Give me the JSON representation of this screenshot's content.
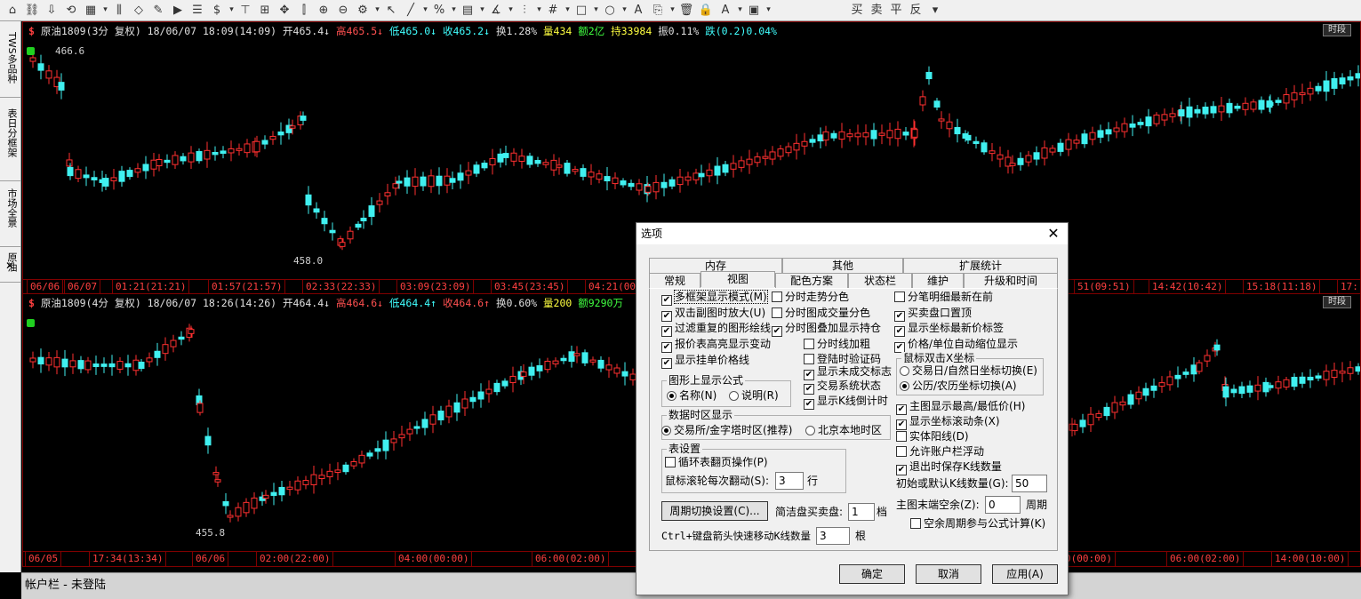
{
  "toolbar": {
    "tools": [
      "⌂",
      "⛓",
      "⇩",
      "⟲",
      "▦",
      "▾",
      "⫼",
      "◇",
      "✎",
      "▶",
      "☰",
      "$",
      "▾",
      "⊤",
      "⊞",
      "✥",
      "⫿",
      "⊕",
      "⊖",
      "⚙",
      "▾",
      "↖",
      "╱",
      "▾",
      "%",
      "▾",
      "▤",
      "▾",
      "∡",
      "▾",
      "⫶",
      "▾",
      "#",
      "▾",
      "□",
      "▾",
      "○",
      "▾",
      "A",
      "⎘",
      "▾",
      "🗑",
      "🔒",
      "A",
      "▾",
      "▣",
      "▾"
    ],
    "labels": [
      "买",
      "卖",
      "平",
      "反",
      "▾"
    ]
  },
  "sidebar": {
    "items": [
      "TWS多品种",
      "表日分框架",
      "市场全景",
      "原油"
    ],
    "close": "✕"
  },
  "chart_top": {
    "dollar": "$",
    "title": "原油1809(3分 复权) 18/06/07 18:09(14:09)",
    "open": "开465.4↓",
    "high": "高465.5↓",
    "low": "低465.0↓",
    "close": "收465.2↓",
    "turnover": "换1.28%",
    "volume": "量434",
    "amount": "额2亿",
    "position": "持33984",
    "amplitude": "振0.11%",
    "change": "跌(0.2)0.04%",
    "history": "时段",
    "high_label": "466.6",
    "low_label": "458.0",
    "times": [
      "06/06",
      "06/07",
      "01:21(21:21)",
      "01:57(21:57)",
      "02:33(22:33)",
      "03:09(23:09)",
      "03:45(23:45)",
      "04:21(00",
      "51(09:51)",
      "14:42(10:42)",
      "15:18(11:18)",
      "17:"
    ]
  },
  "chart_bottom": {
    "dollar": "$",
    "title": "原油1809(4分 复权) 18/06/07 18:26(14:26)",
    "open": "开464.4↓",
    "high": "高464.6↓",
    "low": "低464.4↑",
    "close": "收464.6↑",
    "turnover": "换0.60%",
    "volume": "量200",
    "amount": "额9290万",
    "history": "时段",
    "low_label": "455.8",
    "times": [
      "06/05",
      "17:34(13:34)",
      "06/06",
      "02:00(22:00)",
      "04:00(00:00)",
      "06:00(02:00)",
      "0(00:00)",
      "06:00(02:00)",
      "14:00(10:00)"
    ]
  },
  "status": {
    "text": "帐户栏 - 未登陆"
  },
  "dialog": {
    "title": "选项",
    "close": "✕",
    "tabs_back": [
      "内存",
      "其他",
      "扩展统计"
    ],
    "tabs_front": [
      "常规",
      "视图",
      "配色方案",
      "状态栏",
      "维护",
      "升级和时间"
    ],
    "col1": [
      {
        "label": "多框架显示模式(M)",
        "checked": true
      },
      {
        "label": "双击副图时放大(U)",
        "checked": true
      },
      {
        "label": "过滤重复的图形绘线",
        "checked": true
      },
      {
        "label": "报价表高亮显示变动",
        "checked": true
      },
      {
        "label": "显示挂单价格线",
        "checked": true
      }
    ],
    "formula_group": {
      "title": "图形上显示公式",
      "opt1": "名称(N)",
      "opt2": "说明(R)"
    },
    "col2": [
      {
        "label": "分时走势分色",
        "checked": false
      },
      {
        "label": "分时图成交量分色",
        "checked": false
      },
      {
        "label": "分时图叠加显示持仓",
        "checked": true
      }
    ],
    "col2b": [
      {
        "label": "分时线加粗",
        "checked": false
      },
      {
        "label": "登陆时验证码",
        "checked": false
      },
      {
        "label": "显示未成交标志",
        "checked": true
      },
      {
        "label": "交易系统状态",
        "checked": true
      },
      {
        "label": "显示K线倒计时",
        "checked": true
      }
    ],
    "col3": [
      {
        "label": "分笔明细最新在前",
        "checked": false
      },
      {
        "label": "买卖盘口置顶",
        "checked": true
      },
      {
        "label": "显示坐标最新价标签",
        "checked": true
      },
      {
        "label": "价格/单位自动缩位显示",
        "checked": true
      }
    ],
    "xaxis_group": {
      "title": "鼠标双击X坐标",
      "opt1": "交易日/自然日坐标切换(E)",
      "opt2": "公历/农历坐标切换(A)"
    },
    "col3b": [
      {
        "label": "主图显示最高/最低价(H)",
        "checked": true
      },
      {
        "label": "显示坐标滚动条(X)",
        "checked": true
      },
      {
        "label": "实体阳线(D)",
        "checked": false
      },
      {
        "label": "允许账户栏浮动",
        "checked": false
      },
      {
        "label": "退出时保存K线数量",
        "checked": true
      }
    ],
    "tz_group": {
      "title": "数据时区显示",
      "opt1": "交易所/金字塔时区(推荐)",
      "opt2": "北京本地时区"
    },
    "table_group": {
      "title": "表设置",
      "cycle": "循环表翻页操作(P)",
      "wheel_label": "鼠标滚轮每次翻动(S):",
      "wheel_value": "3",
      "wheel_unit": "行"
    },
    "init_k": {
      "label": "初始或默认K线数量(G):",
      "value": "50"
    },
    "tail_space": {
      "label": "主图末端空余(Z):",
      "value": "0",
      "unit": "周期"
    },
    "empty_cycle": {
      "label": "空余周期参与公式计算(K)",
      "checked": false
    },
    "period_btn": "周期切换设置(C)...",
    "simple_label": "简洁盘买卖盘:",
    "simple_value": "1",
    "simple_unit": "档",
    "ctrl_label": "Ctrl+键盘箭头快速移动K线数量",
    "ctrl_value": "3",
    "ctrl_unit": "根",
    "ok": "确定",
    "cancel": "取消",
    "apply": "应用(A)"
  }
}
